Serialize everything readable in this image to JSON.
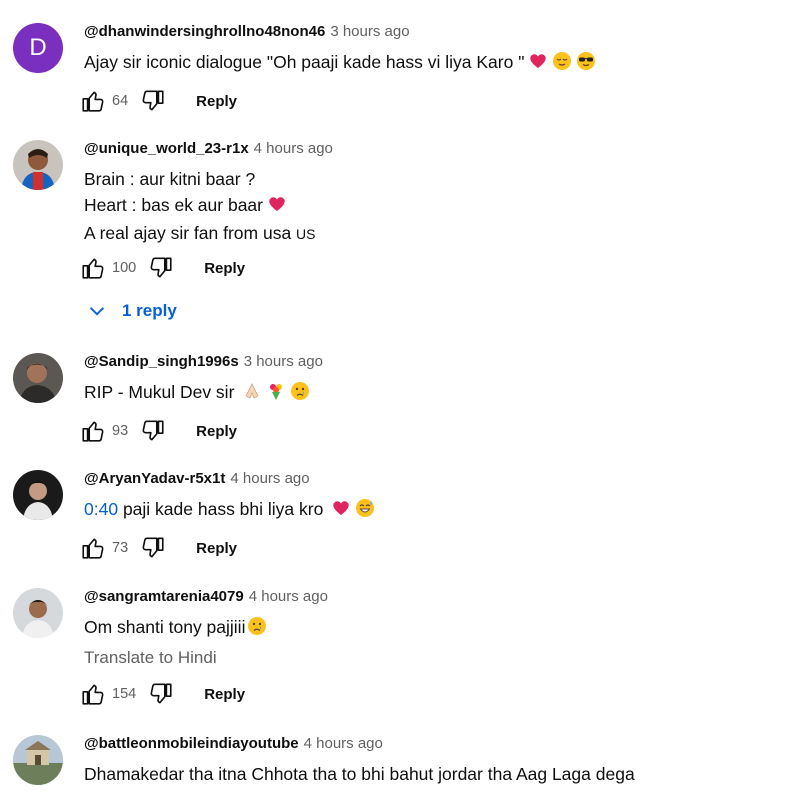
{
  "comments": [
    {
      "avatar_letter": "D",
      "handle": "@dhanwindersinghrollno48non46",
      "time": "3 hours ago",
      "text": "Ajay sir iconic dialogue \"Oh paaji kade hass vi liya Karo \"",
      "emojis": [
        "red-heart",
        "relieved-face",
        "sunglasses-face"
      ],
      "likes": "64",
      "reply_label": "Reply"
    },
    {
      "handle": "@unique_world_23-r1x",
      "time": "4 hours ago",
      "lines": [
        "Brain : aur kitni baar ?",
        "Heart : bas ek aur baar",
        "A real ajay sir fan from usa"
      ],
      "flag_text": "US",
      "emojis": [
        "red-heart"
      ],
      "likes": "100",
      "reply_label": "Reply",
      "replies_label": "1 reply"
    },
    {
      "handle": "@Sandip_singh1996s",
      "time": "3 hours ago",
      "text": "RIP - Mukul Dev sir",
      "emojis": [
        "folded-hands",
        "bouquet",
        "crying-face"
      ],
      "likes": "93",
      "reply_label": "Reply"
    },
    {
      "handle": "@AryanYadav-r5x1t",
      "time": "4 hours ago",
      "timestamp_link": "0:40",
      "text": "paji kade hass bhi liya kro",
      "emojis": [
        "red-heart",
        "grinning-sweat-face"
      ],
      "likes": "73",
      "reply_label": "Reply"
    },
    {
      "handle": "@sangramtarenia4079",
      "time": "4 hours ago",
      "text": "Om shanti tony pajjiii",
      "emojis": [
        "crying-face"
      ],
      "translate_label": "Translate to Hindi",
      "likes": "154",
      "reply_label": "Reply"
    },
    {
      "handle": "@battleonmobileindiayoutube",
      "time": "4 hours ago",
      "text": "Dhamakedar tha itna Chhota tha to bhi bahut jordar tha Aag Laga dega"
    }
  ],
  "colors": {
    "link_blue": "#065fd4",
    "muted": "#606060",
    "avatar_purple": "#7b2fbe",
    "heart_red": "#e0245e"
  }
}
